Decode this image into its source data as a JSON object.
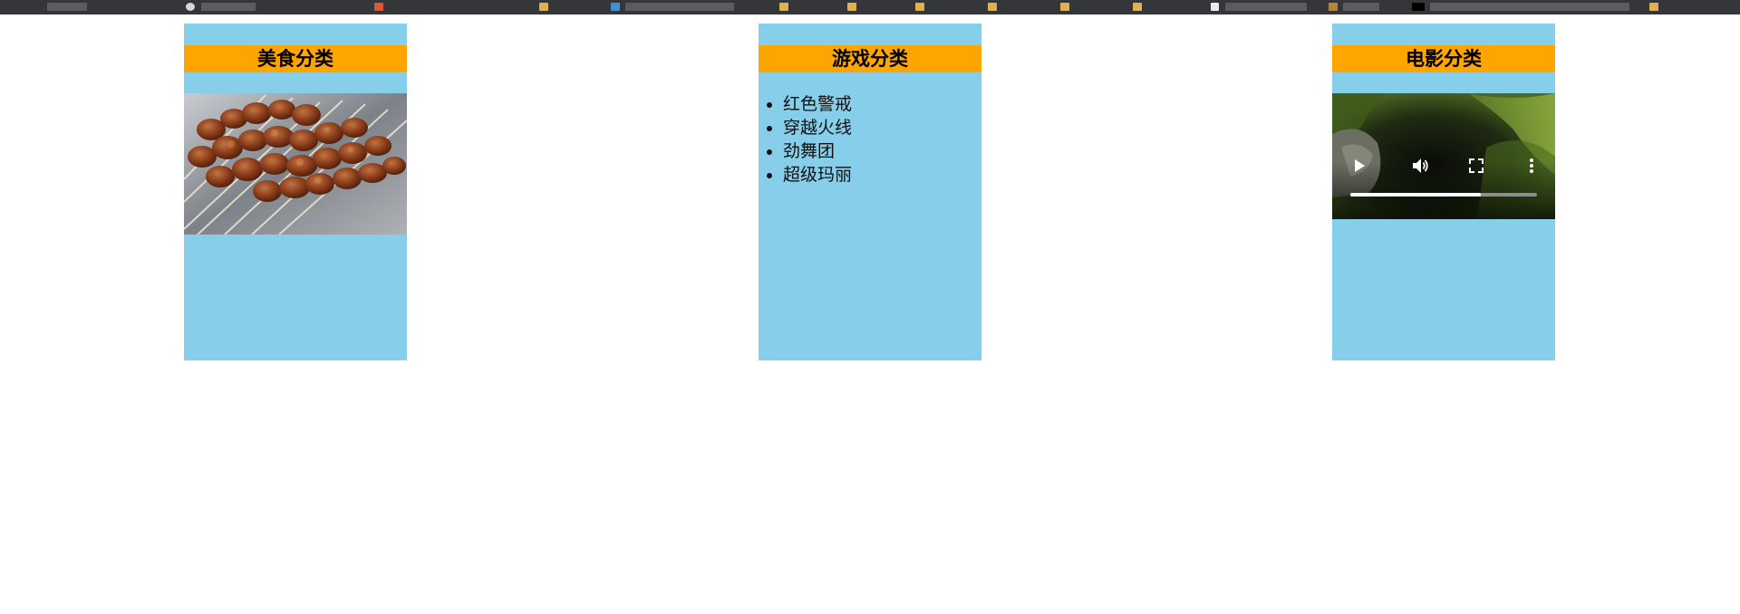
{
  "panels": {
    "food": {
      "title": "美食分类",
      "image": "barbecue-skewers-photo"
    },
    "games": {
      "title": "游戏分类",
      "items": [
        "红色警戒",
        "穿越火线",
        "劲舞团",
        "超级玛丽"
      ]
    },
    "movies": {
      "title": "电影分类",
      "video": {
        "play_icon": "play-icon",
        "volume_icon": "volume-icon",
        "fullscreen_icon": "fullscreen-icon",
        "menu_icon": "more-vertical-icon",
        "progress": 0.7
      }
    }
  },
  "colors": {
    "panel_bg": "#87ceeb",
    "header_bg": "#ffa500",
    "topbar_bg": "#35363a"
  }
}
